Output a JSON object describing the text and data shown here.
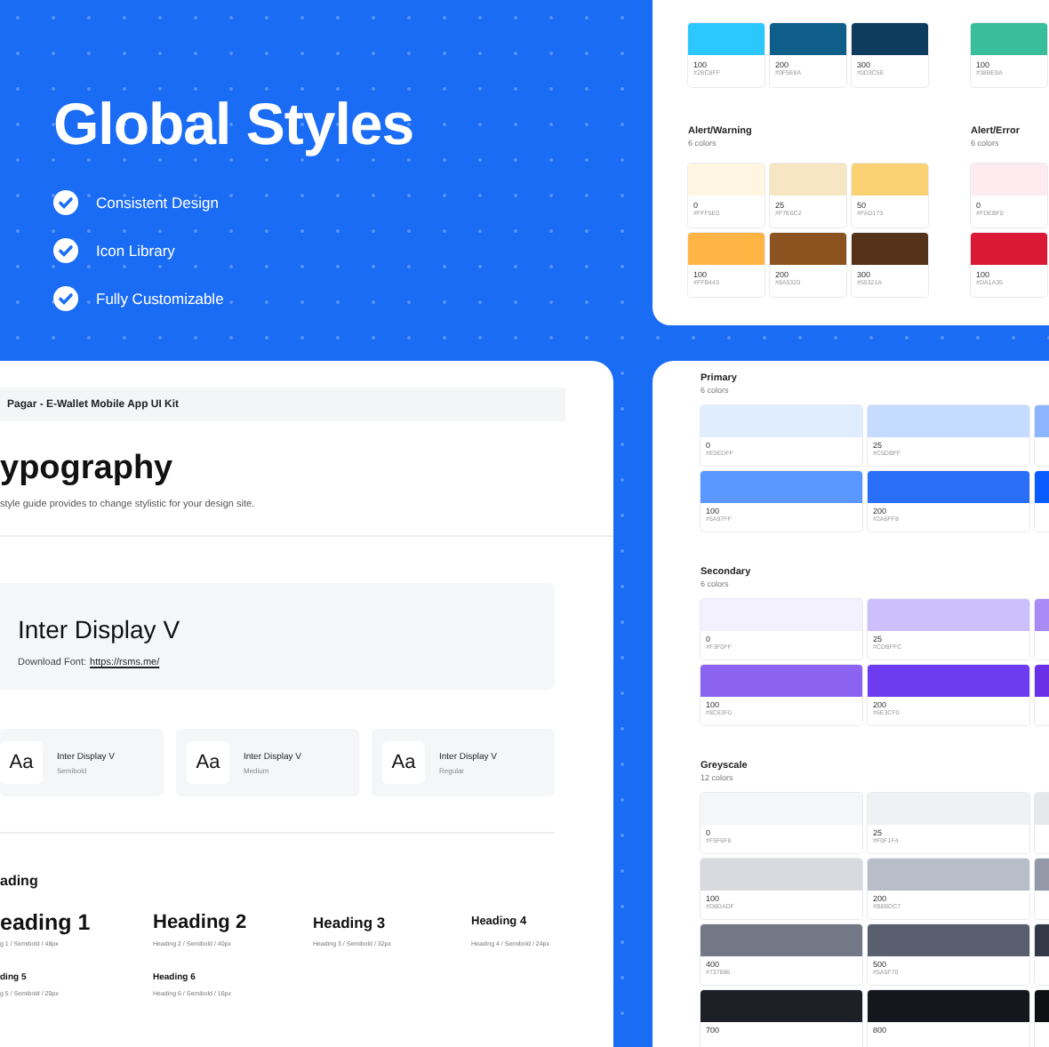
{
  "hero": {
    "title": "Global Styles",
    "features": [
      {
        "label": "Consistent Design",
        "checked": true
      },
      {
        "label": "Icon Library",
        "checked": true
      },
      {
        "label": "Fully Customizable",
        "checked": true
      }
    ]
  },
  "color_panel_top": {
    "columns": [
      {
        "palettes": [
          {
            "swatches": [
              {
                "label": "100",
                "hex": "#2BC8FF",
                "color": "#2bc8ff"
              },
              {
                "label": "200",
                "hex": "#0F5E8A",
                "color": "#0f5e8a"
              },
              {
                "label": "300",
                "hex": "#0D3C5E",
                "color": "#0d3c5e"
              }
            ]
          },
          {
            "title": "Alert/Warning",
            "count": "6 colors",
            "swatches": [
              {
                "label": "0",
                "hex": "#FFF5E0",
                "color": "#fff5e0"
              },
              {
                "label": "25",
                "hex": "#F7E6C2",
                "color": "#f7e6c2"
              },
              {
                "label": "50",
                "hex": "#FAD173",
                "color": "#fad173"
              },
              {
                "label": "100",
                "hex": "#FFB443",
                "color": "#ffb443"
              },
              {
                "label": "200",
                "hex": "#8A5320",
                "color": "#8a5320"
              },
              {
                "label": "300",
                "hex": "#55321A",
                "color": "#55321a"
              }
            ]
          }
        ]
      },
      {
        "palettes": [
          {
            "swatches": [
              {
                "label": "100",
                "hex": "#38BE9A",
                "color": "#38be9a"
              }
            ]
          },
          {
            "title": "Alert/Error",
            "count": "6 colors",
            "swatches": [
              {
                "label": "0",
                "hex": "#FDEBF0",
                "color": "#fdebf0"
              },
              {
                "label": "100",
                "hex": "#DA1A35",
                "color": "#da1a35"
              }
            ]
          }
        ]
      }
    ]
  },
  "typography_panel": {
    "breadcrumb": "Pagar - E-Wallet Mobile App UI Kit",
    "title": "ypography",
    "description": "style guide provides to change stylistic for your design site.",
    "font": {
      "name": "Inter Display V",
      "download_label": "Download Font:",
      "download_link": "https://rsms.me/"
    },
    "weights": [
      {
        "sample": "Aa",
        "name": "Inter Display V",
        "weight": "Semibold"
      },
      {
        "sample": "Aa",
        "name": "Inter Display V",
        "weight": "Medium"
      },
      {
        "sample": "Aa",
        "name": "Inter Display V",
        "weight": "Regular"
      }
    ],
    "section_title": "ading",
    "headings": [
      {
        "kind": "h1",
        "text": "eading 1",
        "spec": "g 1 / Semibold / 48px"
      },
      {
        "kind": "h2",
        "text": "Heading 2",
        "spec": "Heading 2 / Semibold / 40px"
      },
      {
        "kind": "h3",
        "text": "Heading 3",
        "spec": "Heading 3 / Semibold / 32px"
      },
      {
        "kind": "h4",
        "text": "Heading 4",
        "spec": "Heading 4 / Semibold / 24px"
      },
      {
        "kind": "h5",
        "text": "ding 5",
        "spec": "g 5 / Semibold / 20px"
      },
      {
        "kind": "h6",
        "text": "Heading 6",
        "spec": "Heading 6 / Semibold / 16px"
      }
    ]
  },
  "color_panel_bottom": {
    "palettes": [
      {
        "title": "Primary",
        "count": "6 colors",
        "swatches": [
          {
            "label": "0",
            "hex": "#E0EDFF",
            "color": "#e0edff"
          },
          {
            "label": "25",
            "hex": "#C5DBFF",
            "color": "#c5dbff"
          },
          {
            "color": "#8cb4ff"
          },
          {
            "label": "100",
            "hex": "#5A97FF",
            "color": "#5a97ff"
          },
          {
            "label": "200",
            "hex": "#2A6FF8",
            "color": "#2a6ff8"
          },
          {
            "color": "#0a5bff"
          }
        ]
      },
      {
        "title": "Secondary",
        "count": "6 colors",
        "swatches": [
          {
            "label": "0",
            "hex": "#F3F0FF",
            "color": "#f3f0ff"
          },
          {
            "label": "25",
            "hex": "#CDBFFC",
            "color": "#cdbffc"
          },
          {
            "color": "#a88bf5"
          },
          {
            "label": "100",
            "hex": "#8C63F0",
            "color": "#8c63f0"
          },
          {
            "label": "200",
            "hex": "#6E3CF0",
            "color": "#6e3cf0"
          },
          {
            "color": "#6a30e8"
          }
        ]
      },
      {
        "title": "Greyscale",
        "count": "12 colors",
        "swatches": [
          {
            "label": "0",
            "hex": "#F5F6F8",
            "color": "#f5f6f8"
          },
          {
            "label": "25",
            "hex": "#F0F1F4",
            "color": "#f0f1f4"
          },
          {
            "color": "#e6e8ec"
          },
          {
            "label": "100",
            "hex": "#D8DADF",
            "color": "#d8dadf"
          },
          {
            "label": "200",
            "hex": "#B8BDC7",
            "color": "#b8bdc7"
          },
          {
            "color": "#9399a6"
          },
          {
            "label": "400",
            "hex": "#737886",
            "color": "#737886"
          },
          {
            "label": "500",
            "hex": "#5A5F70",
            "color": "#5a5f70"
          },
          {
            "color": "#353846"
          },
          {
            "label": "700",
            "color": "#1e2028"
          },
          {
            "label": "800",
            "color": "#16171c"
          },
          {
            "color": "#0f1014"
          }
        ]
      }
    ]
  }
}
